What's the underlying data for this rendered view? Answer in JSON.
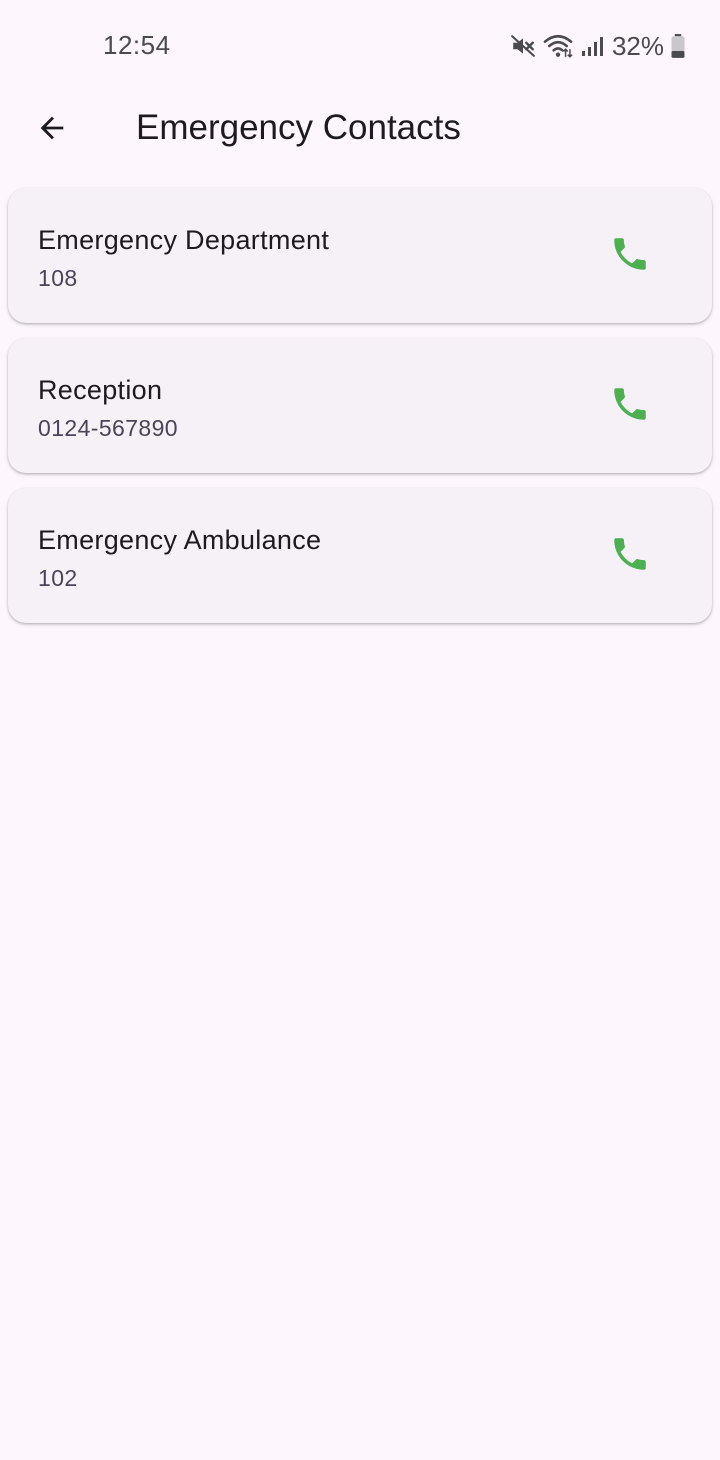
{
  "status_bar": {
    "time": "12:54",
    "battery_percent": "32%",
    "battery_level": 0.32,
    "icons": [
      "mute-icon",
      "wifi-icon",
      "signal-icon",
      "battery-icon"
    ]
  },
  "app_bar": {
    "title": "Emergency Contacts",
    "back_icon": "arrow-back-icon"
  },
  "contacts": [
    {
      "name": "Emergency Department",
      "number": "108",
      "action_icon": "phone-icon"
    },
    {
      "name": "Reception",
      "number": "0124-567890",
      "action_icon": "phone-icon"
    },
    {
      "name": "Emergency Ambulance",
      "number": "102",
      "action_icon": "phone-icon"
    }
  ],
  "colors": {
    "background": "#fdf7fd",
    "card": "#f5f1f6",
    "call_icon": "#4caf50",
    "text_primary": "#1d1b20",
    "text_secondary": "#4a4458"
  }
}
